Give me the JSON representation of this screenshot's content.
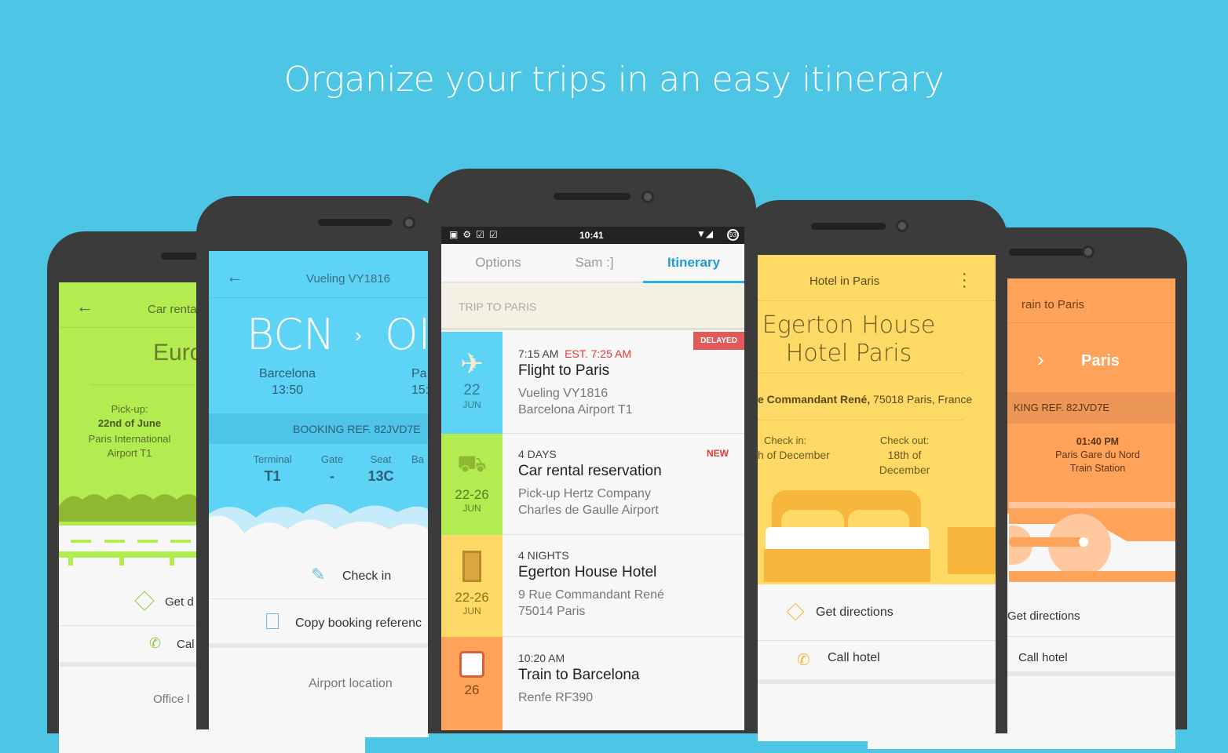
{
  "headline": "Organize your trips in an easy itinerary",
  "colors": {
    "background": "#4dc6e6",
    "flight": "#5dd3f6",
    "car": "#b3ec51",
    "hotel": "#ffd966",
    "train": "#ffa25a",
    "accent": "#1f9ad6",
    "delayed": "#e05a5a"
  },
  "car_phone": {
    "title": "Car renta",
    "company": "Euro",
    "pickup_label": "Pick-up:",
    "pickup_date": "22nd of June",
    "pickup_place": "Paris International Airport T1",
    "actions": [
      "Get d",
      "Cal",
      "Office l"
    ]
  },
  "flight_phone": {
    "title": "Vueling VY1816",
    "from_code": "BCN",
    "to_code": "OI",
    "from_city": "Barcelona",
    "from_time": "13:50",
    "to_city": "Pa",
    "to_time": "15:",
    "booking_ref": "BOOKING REF. 82JVD7E",
    "details": [
      {
        "label": "Terminal",
        "value": "T1"
      },
      {
        "label": "Gate",
        "value": "-"
      },
      {
        "label": "Seat",
        "value": "13C"
      },
      {
        "label": "Ba",
        "value": ""
      }
    ],
    "actions": [
      "Check in",
      "Copy booking referenc",
      "Airport location"
    ]
  },
  "main_phone": {
    "status_time": "10:41",
    "battery": "93",
    "tabs": [
      {
        "label": "Options"
      },
      {
        "label": "Sam :]"
      },
      {
        "label": "Itinerary",
        "active": true
      }
    ],
    "section": "TRIP TO PARIS",
    "items": [
      {
        "icon": "airplane-icon",
        "day": "22",
        "month": "JUN",
        "time": "7:15 AM",
        "est": "EST. 7:25 AM",
        "badge": "DELAYED",
        "title": "Flight to Paris",
        "line1": "Vueling VY1816",
        "line2": "Barcelona Airport T1"
      },
      {
        "icon": "car-icon",
        "day": "22-26",
        "month": "JUN",
        "time": "4 DAYS",
        "badge": "NEW",
        "title": "Car rental reservation",
        "line1": "Pick-up Hertz Company",
        "line2": "Charles de Gaulle Airport"
      },
      {
        "icon": "hotel-icon",
        "day": "22-26",
        "month": "JUN",
        "time": "4 NIGHTS",
        "title": "Egerton House Hotel",
        "line1": "9 Rue Commandant René",
        "line2": "75014 Paris"
      },
      {
        "icon": "train-icon",
        "day": "26",
        "month": "",
        "time": "10:20 AM",
        "title": "Train to Barcelona",
        "line1": "Renfe RF390",
        "line2": ""
      }
    ]
  },
  "hotel_phone": {
    "title": "Hotel in Paris",
    "name_line1": "Egerton House",
    "name_line2": "Hotel Paris",
    "address_bold": "e Commandant René,",
    "address_rest": " 75018 Paris, France",
    "checkin_label": "Check in:",
    "checkin_value": "h of December",
    "checkout_label": "Check out:",
    "checkout_value": "18th of December",
    "actions": [
      "Get directions",
      "Call hotel"
    ]
  },
  "train_phone": {
    "title": "rain to Paris",
    "to_city": "Paris",
    "booking_ref": "KING REF. 82JVD7E",
    "time": "01:40 PM",
    "station": "Paris Gare du Nord Train Station",
    "actions": [
      "Get directions",
      "Call hotel"
    ]
  }
}
